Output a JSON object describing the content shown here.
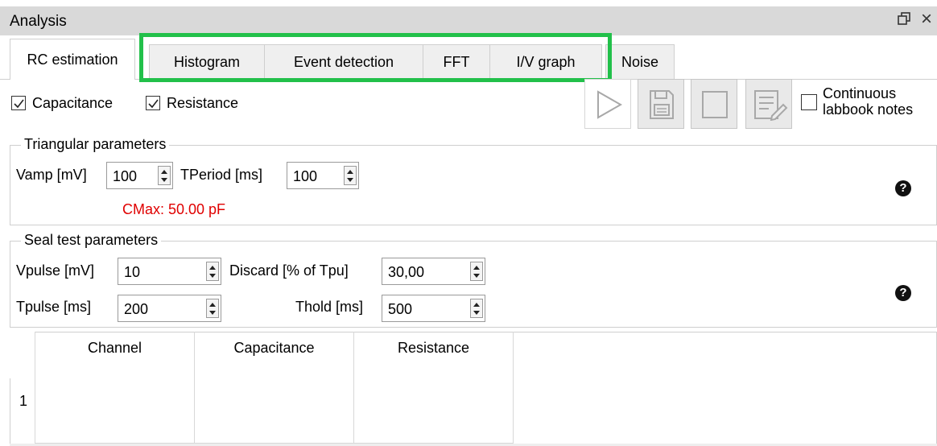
{
  "window": {
    "title": "Analysis",
    "float_glyph": "🗗",
    "close_glyph": "×"
  },
  "tabs": [
    {
      "label": "RC estimation",
      "active": true
    },
    {
      "label": "Histogram",
      "active": false
    },
    {
      "label": "Event detection",
      "active": false
    },
    {
      "label": "FFT",
      "active": false
    },
    {
      "label": "I/V graph",
      "active": false
    },
    {
      "label": "Noise",
      "active": false
    }
  ],
  "highlight_color": "#22c04a",
  "options": {
    "capacitance": {
      "label": "Capacitance",
      "checked": true
    },
    "resistance": {
      "label": "Resistance",
      "checked": true
    }
  },
  "toolbar": {
    "icons": [
      "play-icon",
      "save-icon",
      "stop-icon",
      "labbook-icon"
    ],
    "continuous": {
      "label_line1": "Continuous",
      "label_line2": "labbook notes",
      "checked": false
    }
  },
  "triangular": {
    "title": "Triangular parameters",
    "vamp_label": "Vamp [mV]",
    "vamp_value": "100",
    "tperiod_label": "TPeriod [ms]",
    "tperiod_value": "100",
    "cmax_text": "CMax: 50.00 pF",
    "cmax_color": "#e00000",
    "help_glyph": "?"
  },
  "seal": {
    "title": "Seal test parameters",
    "vpulse_label": "Vpulse [mV]",
    "vpulse_value": "10",
    "discard_label": "Discard [% of Tpu]",
    "discard_value": "30,00",
    "tpulse_label": "Tpulse [ms]",
    "tpulse_value": "200",
    "thold_label": "Thold [ms]",
    "thold_value": "500",
    "help_glyph": "?"
  },
  "table": {
    "columns": [
      "Channel",
      "Capacitance",
      "Resistance"
    ],
    "rows": [
      {
        "index": "1",
        "cells": [
          "",
          "",
          ""
        ]
      }
    ]
  }
}
